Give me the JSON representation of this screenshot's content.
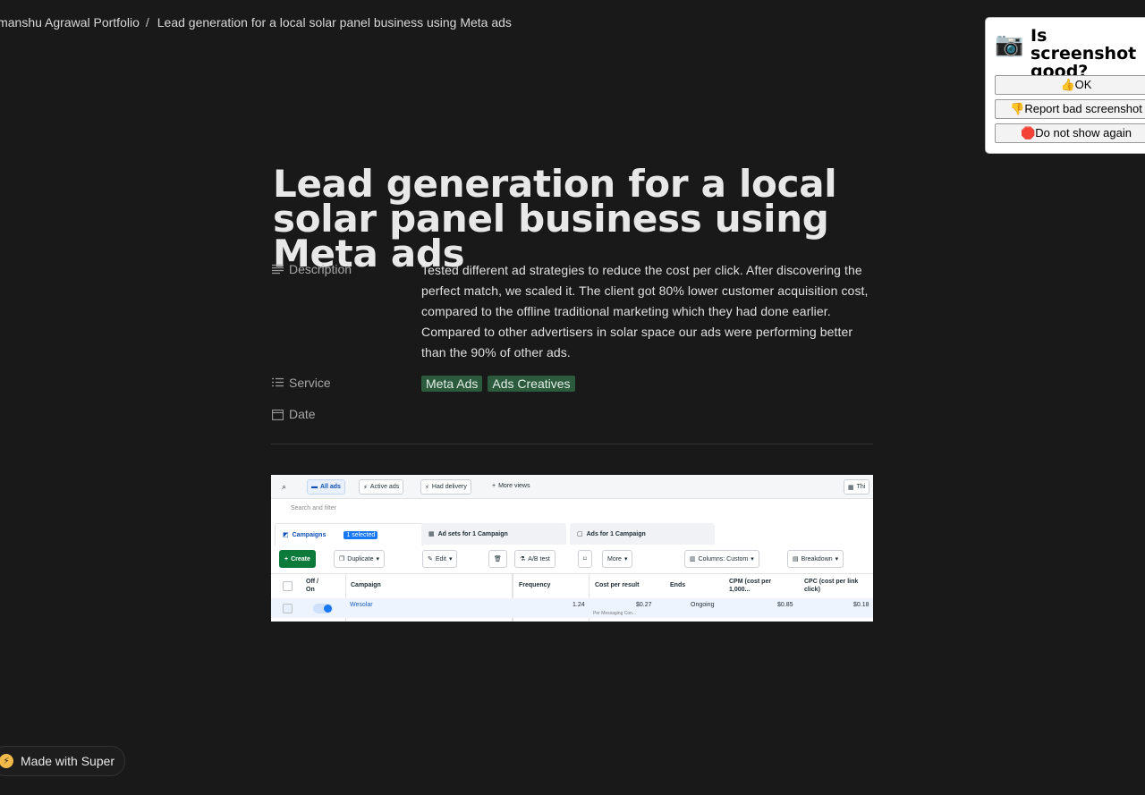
{
  "breadcrumb": {
    "portfolio": "imanshu Agrawal Portfolio",
    "separator": "/",
    "current": "Lead generation for a local solar panel business using Meta ads"
  },
  "page": {
    "title": "Lead generation for a local solar panel business using Meta ads",
    "properties": {
      "description_label": "Description",
      "description_text": "Tested different ad strategies to reduce the cost per click. After discovering the perfect match, we scaled it. The client got 80% lower customer acquisition cost, compared to the offline traditional marketing which they had done earlier. Compared to other advertisers in solar space our ads were performing better than the 90% of other ads.",
      "service_label": "Service",
      "service_tags": [
        "Meta Ads",
        "Ads Creatives"
      ],
      "date_label": "Date"
    },
    "tag_color": "#2c5a3c"
  },
  "ads_manager": {
    "views": [
      "All ads",
      "Active ads",
      "Had delivery",
      "More views"
    ],
    "right_chip": "Thi",
    "search_placeholder": "Search and filter",
    "tabs": {
      "campaigns": "Campaigns",
      "selected": "1 selected",
      "ad_sets": "Ad sets for 1 Campaign",
      "ads": "Ads for 1 Campaign"
    },
    "toolbar": [
      "Create",
      "Duplicate",
      "Edit",
      "A/B test",
      "More",
      "Columns: Custom",
      "Breakdown"
    ],
    "columns": [
      "Off / On",
      "Campaign",
      "Frequency",
      "Cost per result",
      "Ends",
      "CPM (cost per 1,000...",
      "CPC (cost per link click)"
    ],
    "row": {
      "campaign": "Wesolar",
      "frequency": "1.24",
      "cost_per_result": "$0.27",
      "cost_note": "Per Messaging Con...",
      "ends": "Ongoing",
      "cpm": "$0.85",
      "cpc": "$0.18"
    }
  },
  "popup": {
    "question": "Is screenshot good?",
    "ok": "👍OK",
    "report": "👎Report bad screenshot",
    "dont_show": "🛑Do not show again"
  },
  "footer": {
    "made_with": "Made with Super"
  }
}
